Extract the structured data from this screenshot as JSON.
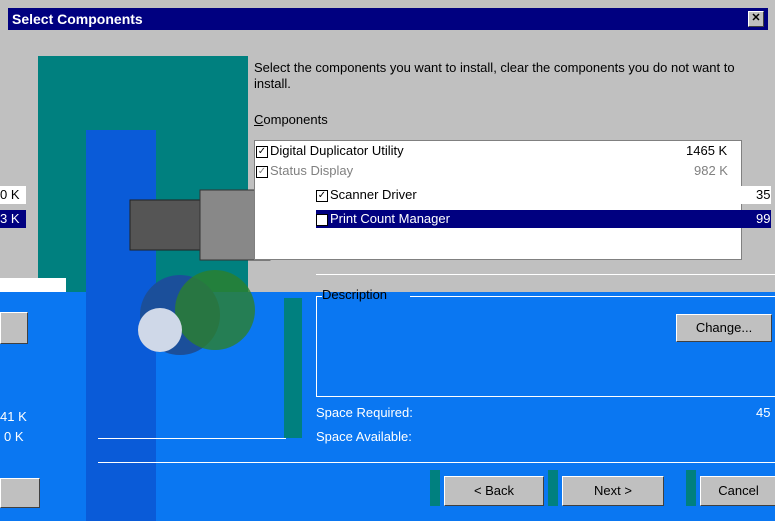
{
  "window": {
    "title": "Select Components",
    "close_icon": "close-icon"
  },
  "instructions": "Select the components you want to install, clear the components you do not want to install.",
  "components_label": "Components",
  "components": [
    {
      "label": "Digital Duplicator Utility",
      "size": "1465 K",
      "checked": true
    },
    {
      "label": "Status Display",
      "size": "982 K",
      "checked": true
    },
    {
      "label": "Scanner Driver",
      "size": "35",
      "checked": true
    },
    {
      "label": "Print Count Manager",
      "size": "99",
      "checked": true
    }
  ],
  "left_fragments": {
    "size_1": "0 K",
    "size_2": "3 K",
    "space_req": "41 K",
    "space_avail": "0 K"
  },
  "description_label": "Description",
  "change_button": "Change...",
  "space_required_label": "Space Required:",
  "space_required_value": "45",
  "space_available_label": "Space Available:",
  "buttons": {
    "back": "< Back",
    "next": "Next >",
    "cancel": "Cancel"
  },
  "colors": {
    "titlebar": "#000080",
    "dialog": "#c0c0c0",
    "artifact_blue": "#0a77f2",
    "artifact_teal": "#00807f"
  }
}
